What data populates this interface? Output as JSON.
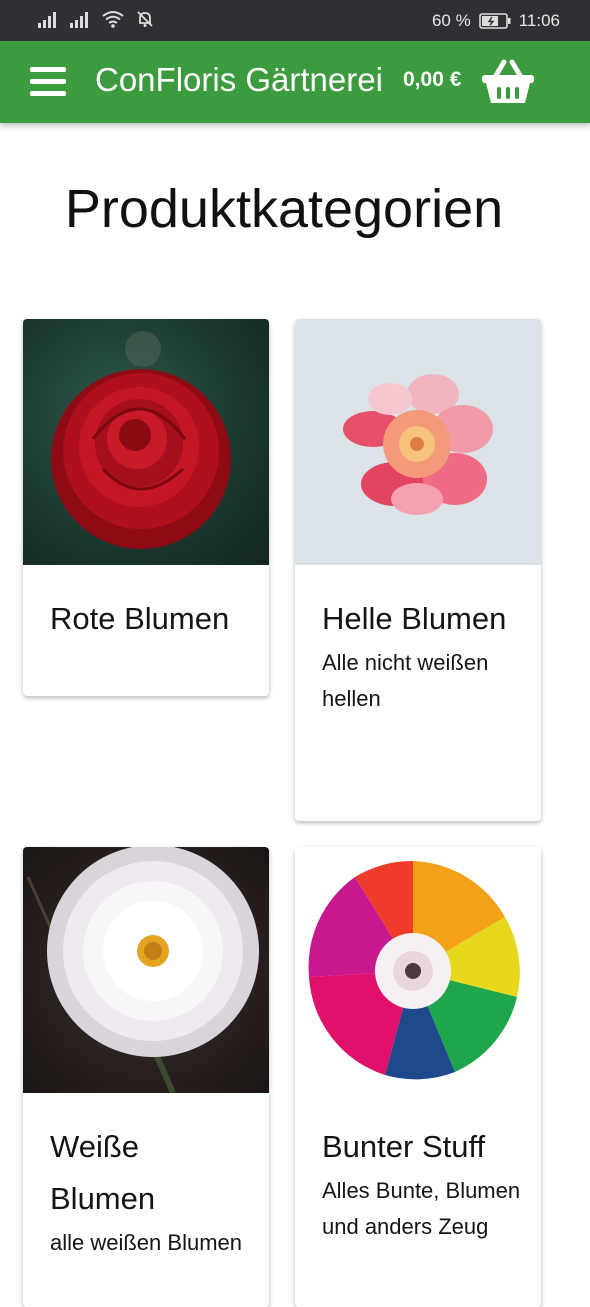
{
  "status_bar": {
    "battery_percent": "60 %",
    "time": "11:06",
    "icons": [
      "signal-icon",
      "signal-icon",
      "wifi-icon",
      "bell-off-icon",
      "battery-icon"
    ]
  },
  "app_bar": {
    "title": "ConFloris Gärtnerei",
    "cart_total": "0,00 €",
    "icons": [
      "menu-icon",
      "basket-icon"
    ],
    "color": "#3c9a3f"
  },
  "page": {
    "heading": "Produktkategorien"
  },
  "categories": [
    {
      "name": "Rote Blumen",
      "description": "",
      "image": "red-rose"
    },
    {
      "name": "Helle Blumen",
      "description": "Alle nicht weißen hellen",
      "image": "pink-flower"
    },
    {
      "name": "Weiße Blumen",
      "description": "alle weißen Blumen",
      "image": "white-dahlia"
    },
    {
      "name": "Bunter Stuff",
      "description": "Alles Bunte, Blumen und anders Zeug",
      "image": "rainbow-flower"
    }
  ]
}
